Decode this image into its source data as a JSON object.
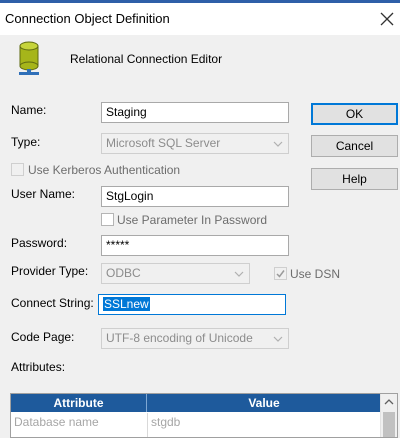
{
  "window": {
    "title": "Connection Object Definition",
    "header_text": "Relational Connection Editor"
  },
  "form": {
    "name_label": "Name:",
    "name_value": "Staging",
    "type_label": "Type:",
    "type_value": "Microsoft SQL Server",
    "kerberos_label": "Use Kerberos Authentication",
    "user_label": "User Name:",
    "user_value": "StgLogin",
    "use_param_label": "Use Parameter In Password",
    "password_label": "Password:",
    "password_value": "*****",
    "provider_label": "Provider Type:",
    "provider_value": "ODBC",
    "use_dsn_label": "Use DSN",
    "use_dsn_checked": true,
    "connect_label": "Connect String:",
    "connect_value": "SSLnew",
    "codepage_label": "Code Page:",
    "codepage_value": "UTF-8 encoding of Unicode",
    "attributes_label": "Attributes:"
  },
  "buttons": {
    "ok": "OK",
    "cancel": "Cancel",
    "help": "Help"
  },
  "grid": {
    "headers": [
      "Attribute",
      "Value"
    ],
    "rows": [
      {
        "attribute": "Database name",
        "value": "stgdb"
      }
    ]
  },
  "colors": {
    "accent": "#0078d7",
    "grid_header": "#1e5a9c"
  }
}
